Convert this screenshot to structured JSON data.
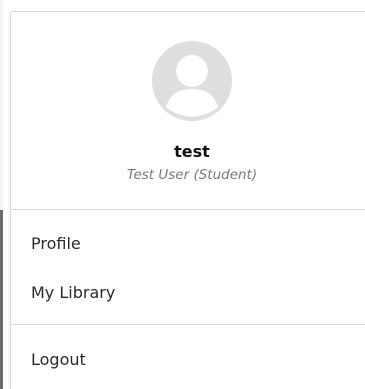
{
  "user": {
    "avatar_icon": "user-circle-icon",
    "username": "test",
    "display_name": "Test User (Student)"
  },
  "menu": {
    "items": [
      {
        "label": "Profile"
      },
      {
        "label": "My Library"
      }
    ],
    "logout_label": "Logout"
  },
  "colors": {
    "avatar_bg": "#dedede",
    "avatar_fg": "#ffffff",
    "divider": "#d9d9d9",
    "secondary_text": "#7a7a7a"
  }
}
